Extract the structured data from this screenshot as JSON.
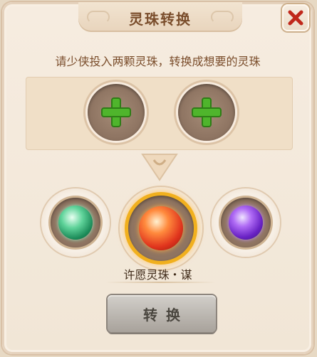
{
  "dialog": {
    "title": "灵珠转换",
    "instruction": "请少侠投入两颗灵珠，转换成想要的灵珠",
    "close_icon": "close-x-icon"
  },
  "input_slots": [
    {
      "icon": "plus-icon",
      "state": "empty"
    },
    {
      "icon": "plus-icon",
      "state": "empty"
    }
  ],
  "orbs": [
    {
      "icon": "green-orb-icon",
      "color": "#3cc47f",
      "selected": false
    },
    {
      "icon": "red-orb-icon",
      "color": "#e8431f",
      "selected": true
    },
    {
      "icon": "purple-orb-icon",
      "color": "#8a3ad8",
      "selected": false
    }
  ],
  "selected_orb_name": "许愿灵珠・谋",
  "convert_button": {
    "label": "转换",
    "enabled": false
  },
  "colors": {
    "accent_red": "#c0281b",
    "plus_green": "#4fb52c",
    "selected_ring": "#f1b01e"
  }
}
